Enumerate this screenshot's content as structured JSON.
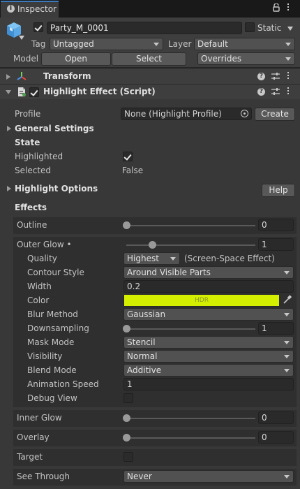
{
  "tab": {
    "title": "Inspector",
    "info_icon": "info-icon",
    "lock_icon": "lock-icon",
    "menu_icon": "kebab-menu-icon"
  },
  "gameobject": {
    "active": true,
    "name": "Party_M_0001",
    "static_label": "Static",
    "static_checked": false,
    "tag_label": "Tag",
    "tag_value": "Untagged",
    "layer_label": "Layer",
    "layer_value": "Default",
    "model_label": "Model",
    "open_label": "Open",
    "select_label": "Select",
    "overrides_label": "Overrides"
  },
  "components": {
    "transform": {
      "title": "Transform"
    },
    "highlight": {
      "title": "Highlight Effect (Script)",
      "enabled": true
    }
  },
  "highlight": {
    "profile_label": "Profile",
    "profile_value": "None (Highlight Profile)",
    "create_label": "Create",
    "general_settings": "General Settings",
    "state": "State",
    "highlighted_label": "Highlighted",
    "highlighted_checked": true,
    "selected_label": "Selected",
    "selected_value": "False",
    "highlight_options": "Highlight Options",
    "help_label": "Help",
    "effects": "Effects",
    "outline_label": "Outline",
    "outline_value": "0",
    "outline_fraction": 0.0,
    "outer_glow_label": "Outer Glow •",
    "outer_glow_value": "1",
    "outer_glow_fraction": 0.2,
    "quality_label": "Quality",
    "quality_value": "Highest",
    "quality_note": "(Screen-Space Effect)",
    "contour_label": "Contour Style",
    "contour_value": "Around Visible Parts",
    "width_label": "Width",
    "width_value": "0.2",
    "color_label": "Color",
    "color_hex": "#d4f000",
    "color_hdr": "HDR",
    "blur_label": "Blur Method",
    "blur_value": "Gaussian",
    "downsampling_label": "Downsampling",
    "downsampling_value": "1",
    "downsampling_fraction": 0.0,
    "mask_label": "Mask Mode",
    "mask_value": "Stencil",
    "visibility_label": "Visibility",
    "visibility_value": "Normal",
    "blend_label": "Blend Mode",
    "blend_value": "Additive",
    "anim_label": "Animation Speed",
    "anim_value": "1",
    "debug_label": "Debug View",
    "debug_checked": false,
    "inner_glow_label": "Inner Glow",
    "inner_glow_value": "0",
    "inner_glow_fraction": 0.0,
    "overlay_label": "Overlay",
    "overlay_value": "0",
    "overlay_fraction": 0.0,
    "target_label": "Target",
    "target_checked": false,
    "see_through_label": "See Through",
    "see_through_value": "Never"
  }
}
